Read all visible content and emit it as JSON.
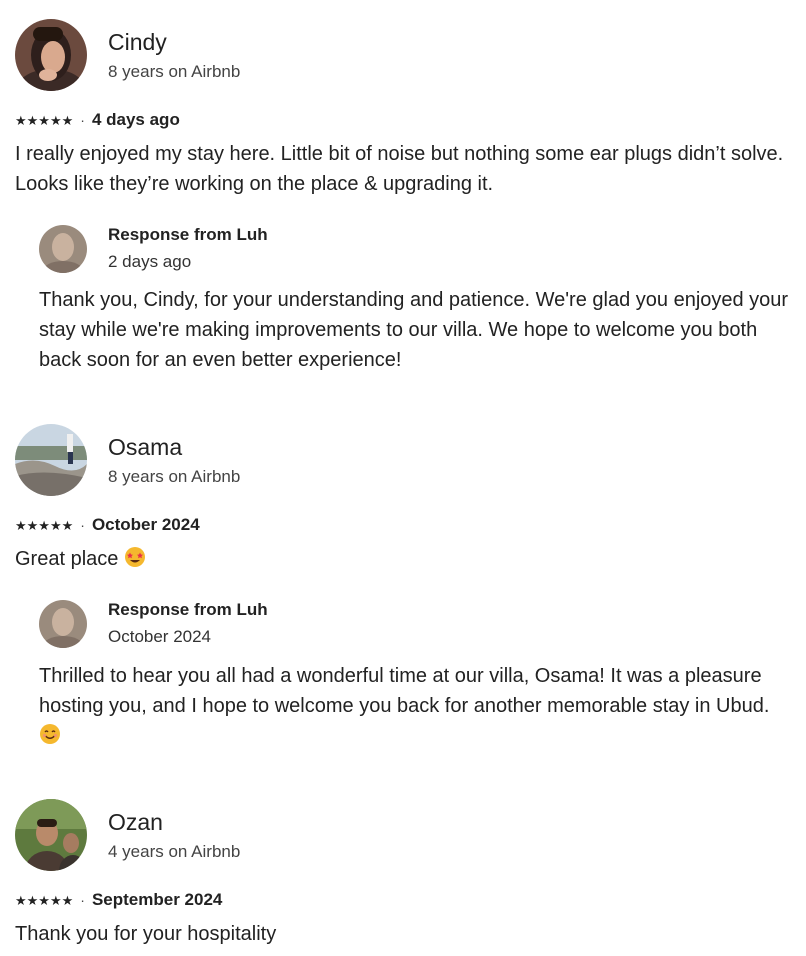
{
  "reviews": [
    {
      "name": "Cindy",
      "tenure": "8 years on Airbnb",
      "stars": "★★★★★",
      "separator": "·",
      "date": "4 days ago",
      "comment": "I really enjoyed my stay here. Little bit of noise but nothing some ear plugs didn’t solve. Looks like they’re working on the place & upgrading it.",
      "response": {
        "title": "Response from Luh",
        "date": "2 days ago",
        "text": "Thank you, Cindy, for your understanding and patience. We're glad you enjoyed your stay while we're making improvements to our villa. We hope to welcome you both back soon for an even better experience!"
      }
    },
    {
      "name": "Osama",
      "tenure": "8 years on Airbnb",
      "stars": "★★★★★",
      "separator": "·",
      "date": "October 2024",
      "comment": "Great place",
      "comment_emoji": "star-struck-emoji",
      "response": {
        "title": "Response from Luh",
        "date": "October 2024",
        "text": "Thrilled to hear you all had a wonderful time at our villa, Osama! It was a pleasure hosting you, and I hope to welcome you back for another memorable stay in Ubud.",
        "text_emoji": "smiling-face-emoji"
      }
    },
    {
      "name": "Ozan",
      "tenure": "4 years on Airbnb",
      "stars": "★★★★★",
      "separator": "·",
      "date": "September 2024",
      "comment": "Thank you for your hospitality"
    }
  ],
  "rating": 5,
  "colors": {
    "text": "#222222",
    "secondary": "#444444",
    "emoji": "#F5B82E"
  }
}
